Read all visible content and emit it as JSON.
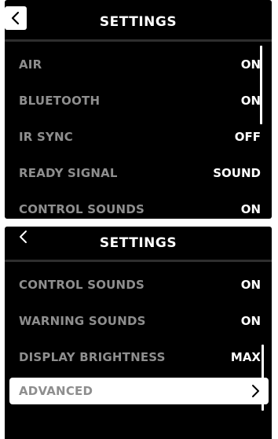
{
  "screens": [
    {
      "title": "SETTINGS",
      "back_icon": "chevron-left-icon",
      "items": [
        {
          "label": "AIR",
          "value": "ON"
        },
        {
          "label": "BLUETOOTH",
          "value": "ON"
        },
        {
          "label": "IR SYNC",
          "value": "OFF"
        },
        {
          "label": "READY SIGNAL",
          "value": "SOUND"
        },
        {
          "label": "CONTROL SOUNDS",
          "value": "ON"
        }
      ]
    },
    {
      "title": "SETTINGS",
      "back_icon": "chevron-left-icon",
      "items": [
        {
          "label": "CONTROL SOUNDS",
          "value": "ON"
        },
        {
          "label": "WARNING SOUNDS",
          "value": "ON"
        },
        {
          "label": "DISPLAY BRIGHTNESS",
          "value": "MAX"
        },
        {
          "label": "ADVANCED",
          "icon": "chevron-right-icon",
          "selected": true
        }
      ]
    }
  ],
  "colors": {
    "background": "#000000",
    "label": "#8e8e8e",
    "value": "#ffffff",
    "highlight": "#ffffff"
  }
}
